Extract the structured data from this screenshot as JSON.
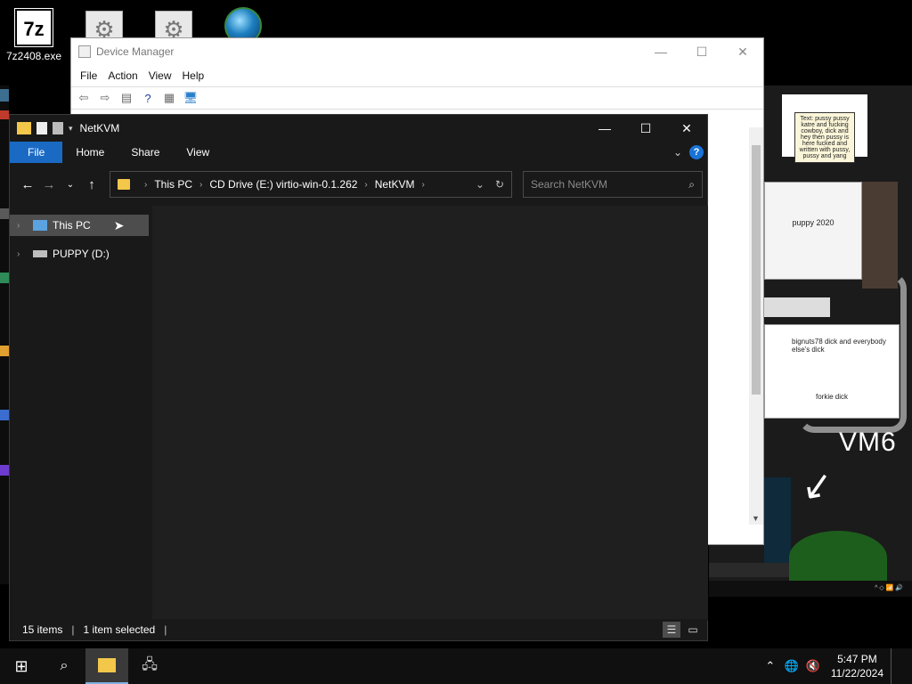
{
  "desktop": {
    "icons": [
      {
        "label": "7z2408.exe",
        "icon": "sevenzip-icon",
        "glyph": "7z"
      },
      {
        "label": "",
        "icon": "settings-gear-icon"
      },
      {
        "label": "",
        "icon": "settings-gear-icon"
      },
      {
        "label": "",
        "icon": "browser-globe-icon"
      }
    ],
    "collage": {
      "note_top": "Text: pussy pussy katre and fucking cowboy, dick and hey then pussy is here fucked and written with pussy, pussy and yang",
      "note_mid": "dick and everybody else's dick",
      "note_mid_prefix": "bignuts78",
      "note_low": "forkie dick",
      "vm_label": "VM6",
      "sketch_label": "puppy 2020"
    }
  },
  "device_manager": {
    "title": "Device Manager",
    "menu": [
      "File",
      "Action",
      "View",
      "Help"
    ],
    "window_buttons": {
      "minimize": "—",
      "maximize": "☐",
      "close": "✕"
    }
  },
  "explorer": {
    "title": "NetKVM",
    "window_buttons": {
      "minimize": "—",
      "maximize": "☐",
      "close": "✕"
    },
    "ribbon_tabs": [
      "File",
      "Home",
      "Share",
      "View"
    ],
    "breadcrumb": [
      "This PC",
      "CD Drive (E:) virtio-win-0.1.262",
      "NetKVM"
    ],
    "search_placeholder": "Search NetKVM",
    "nav_items": [
      {
        "label": "This PC",
        "selected": true
      },
      {
        "label": "PUPPY (D:)",
        "selected": false
      }
    ],
    "status": {
      "items": "15 items",
      "selected": "1 item selected"
    }
  },
  "taskbar": {
    "time": "5:47 PM",
    "date": "11/22/2024"
  },
  "colors": {
    "accent": "#1a6ac4",
    "folder": "#f3c74a",
    "explorer_bg": "#191919"
  }
}
